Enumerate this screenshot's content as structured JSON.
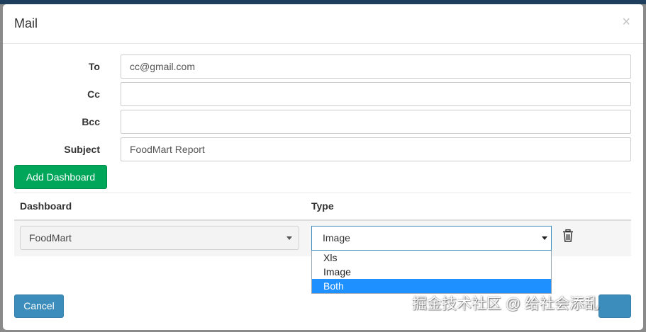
{
  "modal": {
    "title": "Mail",
    "close_glyph": "×"
  },
  "form": {
    "to_label": "To",
    "to_value": "cc@gmail.com",
    "cc_label": "Cc",
    "cc_value": "",
    "bcc_label": "Bcc",
    "bcc_value": "",
    "subject_label": "Subject",
    "subject_value": "FoodMart Report"
  },
  "add_dashboard_label": "Add Dashboard",
  "table": {
    "headers": [
      "Dashboard",
      "Type"
    ],
    "row": {
      "dashboard": "FoodMart",
      "type": "Image"
    }
  },
  "type_dropdown": {
    "options": [
      "Xls",
      "Image",
      "Both"
    ],
    "highlighted": "Both"
  },
  "footer": {
    "cancel_label": "Cancel"
  },
  "watermark": "掘金技术社区 @ 给社会添乱",
  "colors": {
    "accent": "#3c8dbc",
    "success": "#00a65a",
    "highlight": "#1e90ff"
  },
  "icons": {
    "trash": "trash-icon",
    "close": "close-icon",
    "caret": "chevron-down-icon"
  }
}
